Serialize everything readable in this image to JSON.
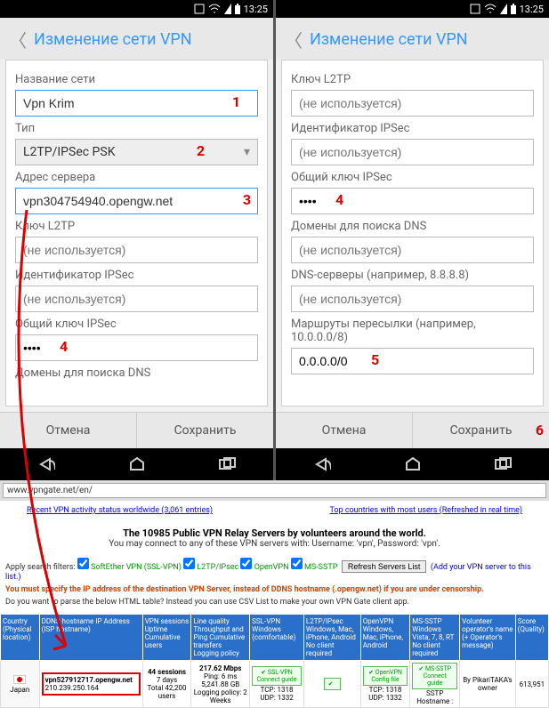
{
  "status": {
    "time": "13:25"
  },
  "dialog_title": "Изменение сети VPN",
  "left": {
    "name_label": "Название сети",
    "name_value": "Vpn Krim",
    "type_label": "Тип",
    "type_value": "L2TP/IPSec PSK",
    "server_label": "Адрес сервера",
    "server_value": "vpn304754940.opengw.net",
    "l2tp_label": "Ключ L2TP",
    "l2tp_ph": "(не используется)",
    "ipsec_id_label": "Идентификатор IPSec",
    "ipsec_id_ph": "(не используется)",
    "ipsec_key_label": "Общий ключ IPSec",
    "ipsec_key_value": "••••",
    "dns_label": "Домены для поиска DNS"
  },
  "right": {
    "l2tp_label": "Ключ L2TP",
    "l2tp_ph": "(не используется)",
    "ipsec_id_label": "Идентификатор IPSec",
    "ipsec_id_ph": "(не используется)",
    "ipsec_key_label": "Общий ключ IPSec",
    "ipsec_key_value": "••••",
    "dns_label": "Домены для поиска DNS",
    "dns_ph": "(не используется)",
    "dns_servers_label": "DNS-серверы (например, 8.8.8.8)",
    "dns_servers_ph": "(не используется)",
    "routes_label": "Маршруты пересылки (например, 10.0.0.0/8)",
    "routes_value": "0.0.0.0/0"
  },
  "buttons": {
    "cancel": "Отмена",
    "save": "Сохранить"
  },
  "markers": {
    "m1": "1",
    "m2": "2",
    "m3": "3",
    "m4": "4",
    "m5": "5",
    "m6": "6"
  },
  "browser": {
    "url": "www.vpngate.net/en/",
    "link_recent": "Recent VPN activity status worldwide (3,061 entries)",
    "link_top": "Top countries with most users (Refreshed in real time)",
    "headline1": "The 10985 Public VPN Relay Servers by volunteers around the world.",
    "headline2": "You may connect to any of these VPN servers with: Username: 'vpn', Password: 'vpn'.",
    "filters_label": "Apply search filters:",
    "f1": "SoftEther VPN (SSL-VPN)",
    "f2": "L2TP/IPsec",
    "f3": "OpenVPN",
    "f4": "MS-SSTP",
    "refresh": "Refresh Servers List",
    "addhint": "(Add your VPN server to this list.)",
    "warn": "You must specify the IP address of the destination VPN Server, instead of DDNS hostname (.opengw.net) if you are under censorship.",
    "parse": "Do you want to parse the below HTML table? Instead you can use CSV List to make your own VPN Gate client app.",
    "th": {
      "c1": "Country (Physical location)",
      "c2": "DDNS hostname IP Address (ISP hostname)",
      "c3": "VPN sessions Uptime Cumulative users",
      "c4": "Line quality Throughput and Ping Cumulative transfers Logging policy",
      "c5": "SSL-VPN Windows (comfortable)",
      "c6": "L2TP/IPsec Windows, Mac, iPhone, Android No client required",
      "c7": "OpenVPN Windows, Mac, iPhone, Android",
      "c8": "MS-SSTP Windows Vista, 7, 8, RT No client required",
      "c9": "Volunteer operator's name (+ Operator's message)",
      "c10": "Score (Quality)"
    },
    "row": {
      "country": "Japan",
      "host": "vpn527912717.opengw.net",
      "ip": "210.239.250.164",
      "sessions": "44 sessions",
      "uptime": "7 days",
      "users": "Total 42,200 users",
      "speed": "217.62 Mbps",
      "ping": "Ping: 6 ms",
      "transfer": "5,241.88 GB",
      "log": "Logging policy: 2 Weeks",
      "ssl": "SSL-VPN Connect guide",
      "tcp": "TCP: 1318",
      "udp": "UDP: 1332",
      "ovpn": "OpenVPN Config file",
      "sstp": "MS-SSTP Connect guide",
      "sstph": "SSTP Hostname :",
      "owner": "By PikariTAKA's owner",
      "score": "613,951"
    }
  }
}
